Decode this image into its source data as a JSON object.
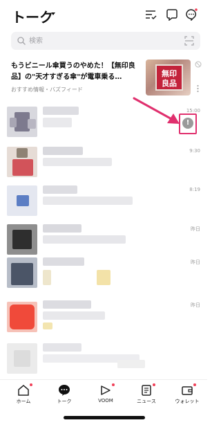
{
  "header": {
    "title": "トーク"
  },
  "search": {
    "placeholder": "検索"
  },
  "ad": {
    "title": "もうビニール傘買うのやめた！【無印良品】の\"天才すぎる傘\"が電車乗る…",
    "source": "おすすめ情報・バズフィード",
    "thumb_sign": [
      "無印",
      "良品"
    ]
  },
  "chats": [
    {
      "time": "15:00",
      "has_alert": true
    },
    {
      "time": "9:30"
    },
    {
      "time": "8:19"
    },
    {
      "time": "昨日"
    },
    {
      "time": "昨日"
    },
    {
      "time": "昨日"
    },
    {
      "time": ""
    }
  ],
  "alert_badge": "!",
  "nav": {
    "items": [
      {
        "label": "ホーム",
        "icon": "home-icon"
      },
      {
        "label": "トーク",
        "icon": "chat-icon"
      },
      {
        "label": "VOOM",
        "icon": "voom-icon"
      },
      {
        "label": "ニュース",
        "icon": "news-icon"
      },
      {
        "label": "ウォレット",
        "icon": "wallet-icon"
      }
    ]
  },
  "colors": {
    "highlight": "#e0306e",
    "notification_dot": "#f04058",
    "alert_badge": "#9a9a9a"
  }
}
